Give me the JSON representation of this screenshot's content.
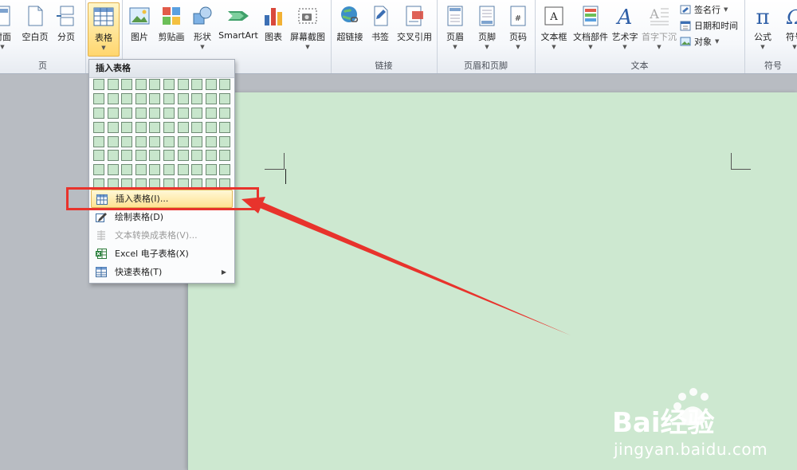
{
  "ribbon": {
    "groups": {
      "pages": {
        "label": "页",
        "buttons": [
          {
            "label": "封面",
            "icon": "cover-page-icon"
          },
          {
            "label": "空白页",
            "icon": "blank-page-icon"
          },
          {
            "label": "分页",
            "icon": "page-break-icon"
          }
        ]
      },
      "tables": {
        "buttons": [
          {
            "label": "表格",
            "icon": "table-icon"
          }
        ]
      },
      "illustrations": {
        "buttons": [
          {
            "label": "图片",
            "icon": "picture-icon"
          },
          {
            "label": "剪贴画",
            "icon": "clip-art-icon"
          },
          {
            "label": "形状",
            "icon": "shapes-icon"
          },
          {
            "label": "SmartArt",
            "icon": "smartart-icon"
          },
          {
            "label": "图表",
            "icon": "chart-icon"
          },
          {
            "label": "屏幕截图",
            "icon": "screenshot-icon"
          }
        ]
      },
      "links": {
        "label": "链接",
        "buttons": [
          {
            "label": "超链接",
            "icon": "hyperlink-icon"
          },
          {
            "label": "书签",
            "icon": "bookmark-icon"
          },
          {
            "label": "交叉引用",
            "icon": "cross-reference-icon"
          }
        ]
      },
      "header_footer": {
        "label": "页眉和页脚",
        "buttons": [
          {
            "label": "页眉",
            "icon": "header-icon"
          },
          {
            "label": "页脚",
            "icon": "footer-icon"
          },
          {
            "label": "页码",
            "icon": "page-number-icon"
          }
        ]
      },
      "text": {
        "label": "文本",
        "buttons": [
          {
            "label": "文本框",
            "icon": "text-box-icon"
          },
          {
            "label": "文档部件",
            "icon": "quick-parts-icon"
          },
          {
            "label": "艺术字",
            "icon": "wordart-icon"
          },
          {
            "label": "首字下沉",
            "icon": "drop-cap-icon"
          }
        ],
        "small_buttons": [
          {
            "label": "签名行",
            "icon": "signature-line-icon"
          },
          {
            "label": "日期和时间",
            "icon": "date-time-icon"
          },
          {
            "label": "对象",
            "icon": "object-icon"
          }
        ]
      },
      "symbols": {
        "label": "符号",
        "buttons": [
          {
            "label": "公式",
            "icon": "equation-icon"
          },
          {
            "label": "符号",
            "icon": "symbol-icon"
          }
        ]
      }
    }
  },
  "dropdown": {
    "header": "插入表格",
    "grid": {
      "columns": 10,
      "rows": 8
    },
    "items": [
      {
        "label": "插入表格(I)...",
        "icon": "insert-table-icon",
        "highlighted": true
      },
      {
        "label": "绘制表格(D)",
        "icon": "draw-table-icon"
      },
      {
        "label": "文本转换成表格(V)...",
        "icon": "convert-text-table-icon",
        "disabled": true
      },
      {
        "label": "Excel 电子表格(X)",
        "icon": "excel-icon"
      },
      {
        "label": "快速表格(T)",
        "icon": "quick-tables-icon",
        "submenu": true
      }
    ]
  },
  "annotation": {
    "color": "#e8332c"
  },
  "watermark": {
    "text": "jingyan.baidu.com",
    "logo": "Bai经验"
  },
  "colors": {
    "page": "#cde8d0",
    "highlight": "#ffe392",
    "accent_red": "#e8332c"
  }
}
